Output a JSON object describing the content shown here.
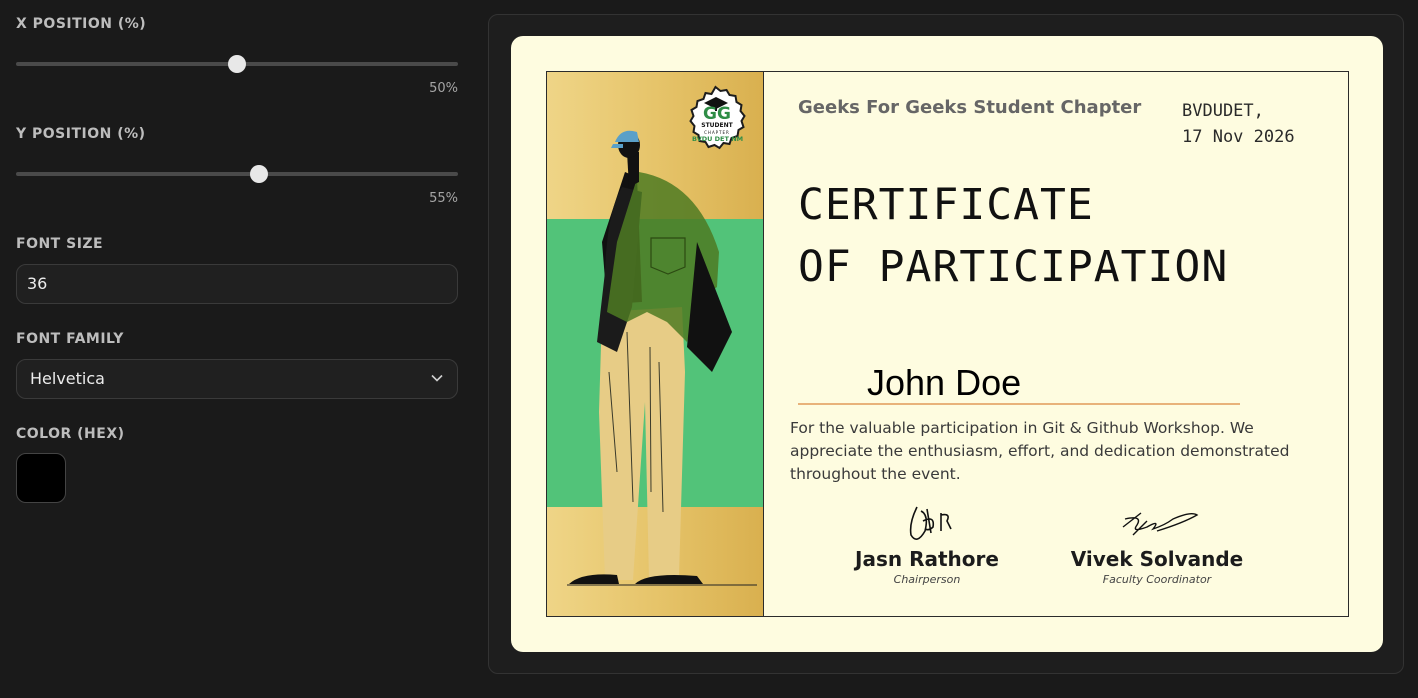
{
  "controls": {
    "x_position": {
      "label": "X POSITION (%)",
      "value": 50,
      "value_text": "50%"
    },
    "y_position": {
      "label": "Y POSITION (%)",
      "value": 55,
      "value_text": "55%"
    },
    "font_size": {
      "label": "FONT SIZE",
      "value": "36"
    },
    "font_family": {
      "label": "FONT FAMILY",
      "selected": "Helvetica"
    },
    "color": {
      "label": "COLOR (HEX)",
      "value": "#000000"
    }
  },
  "certificate": {
    "org_name": "Geeks For Geeks Student Chapter",
    "place": "BVDUDET,",
    "date": "17 Nov 2026",
    "title_line1": "CERTIFICATE",
    "title_line2": "OF PARTICIPATION",
    "recipient": "John Doe",
    "description": "For the valuable participation in Git & Github Workshop. We appreciate the enthusiasm, effort, and dedication demonstrated throughout the event.",
    "logo": {
      "brand": "GG",
      "line1": "STUDENT",
      "line2": "CHAPTER",
      "line3": "BVDU DET NM"
    },
    "signatories": [
      {
        "name": "Jasn Rathore",
        "role": "Chairperson"
      },
      {
        "name": "Vivek Solvande",
        "role": "Faculty Coordinator"
      }
    ],
    "colors": {
      "card_bg": "#fefce0",
      "art_gold": "#e6c46a",
      "art_green": "#52c379",
      "accent_line": "#e8b27a"
    }
  }
}
